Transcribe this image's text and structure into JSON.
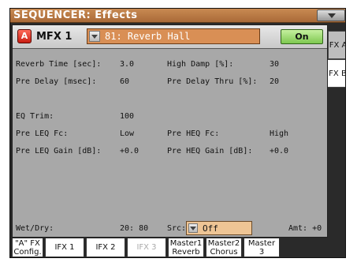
{
  "window": {
    "title": "SEQUENCER: Effects"
  },
  "fx_header": {
    "a_label": "A",
    "mfx_label": "MFX 1",
    "effect_type": "81: Reverb Hall",
    "on_label": "On"
  },
  "params": {
    "reverb_time_label": "Reverb Time [sec]:",
    "reverb_time_value": "3.0",
    "high_damp_label": "High Damp [%]:",
    "high_damp_value": "30",
    "pre_delay_label": "Pre Delay [msec]:",
    "pre_delay_value": "60",
    "pre_delay_thru_label": "Pre Delay Thru [%]:",
    "pre_delay_thru_value": "20",
    "eq_trim_label": "EQ Trim:",
    "eq_trim_value": "100",
    "pre_leq_fc_label": "Pre LEQ Fc:",
    "pre_leq_fc_value": "Low",
    "pre_heq_fc_label": "Pre HEQ Fc:",
    "pre_heq_fc_value": "High",
    "pre_leq_gain_label": "Pre LEQ Gain [dB]:",
    "pre_leq_gain_value": "+0.0",
    "pre_heq_gain_label": "Pre HEQ Gain [dB]:",
    "pre_heq_gain_value": "+0.0",
    "wet_dry_label": "Wet/Dry:",
    "wet_dry_value": "20: 80",
    "src_label": "Src:",
    "src_value": "Off",
    "amt_label": "Amt: +0"
  },
  "side_tabs": {
    "fx_a": "FX A",
    "fx_b": "FX B"
  },
  "bottom_tabs": {
    "a_fx_config_1": "\"A\" FX",
    "a_fx_config_2": "Config.",
    "ifx1": "IFX 1",
    "ifx2": "IFX 2",
    "ifx3": "IFX 3",
    "master1_1": "Master1",
    "master1_2": "Reverb",
    "master2_1": "Master2",
    "master2_2": "Chorus",
    "master3_1": "Master",
    "master3_2": "3"
  }
}
